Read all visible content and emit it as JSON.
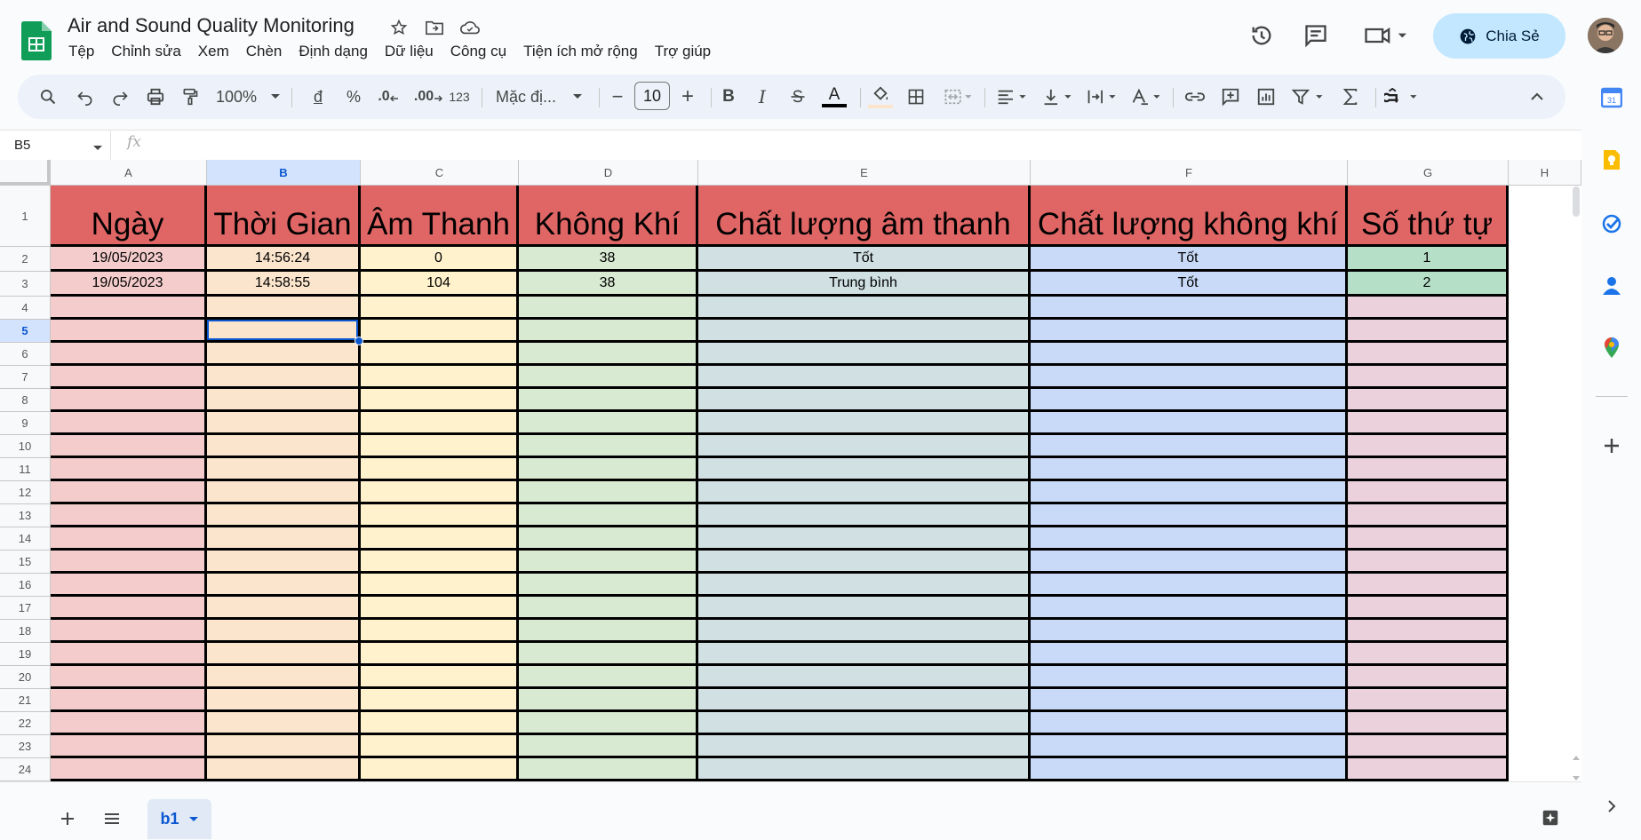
{
  "app": {
    "title": "Air and Sound Quality Monitoring",
    "menus": [
      "Tệp",
      "Chỉnh sửa",
      "Xem",
      "Chèn",
      "Định dạng",
      "Dữ liệu",
      "Công cụ",
      "Tiện ích mở rộng",
      "Trợ giúp"
    ],
    "share_label": "Chia Sẻ"
  },
  "toolbar": {
    "zoom": "100%",
    "currency": "đ",
    "percent": "%",
    "dec_decrease": ".0",
    "dec_increase": ".00",
    "number_format": "123",
    "font": "Mặc đị...",
    "font_size": "10",
    "minus": "−",
    "plus": "+",
    "bold": "B",
    "italic": "I",
    "text_color": "A"
  },
  "formula_bar": {
    "name_box": "B5",
    "fx": "fx",
    "value": ""
  },
  "columns": [
    "A",
    "B",
    "C",
    "D",
    "E",
    "F",
    "G",
    "H"
  ],
  "selected_cell": "B5",
  "rows": [
    {
      "num": "1",
      "cells": [
        "Ngày",
        "Thời Gian",
        "Âm Thanh",
        "Không Khí",
        "Chất lượng âm thanh",
        "Chất lượng không khí",
        "Số thứ tự"
      ]
    },
    {
      "num": "2",
      "cells": [
        "19/05/2023",
        "14:56:24",
        "0",
        "38",
        "Tốt",
        "Tốt",
        "1"
      ]
    },
    {
      "num": "3",
      "cells": [
        "19/05/2023",
        "14:58:55",
        "104",
        "38",
        "Trung bình",
        "Tốt",
        "2"
      ]
    },
    {
      "num": "4",
      "cells": [
        "",
        "",
        "",
        "",
        "",
        "",
        ""
      ]
    },
    {
      "num": "5",
      "cells": [
        "",
        "",
        "",
        "",
        "",
        "",
        ""
      ]
    },
    {
      "num": "6",
      "cells": [
        "",
        "",
        "",
        "",
        "",
        "",
        ""
      ]
    },
    {
      "num": "7",
      "cells": [
        "",
        "",
        "",
        "",
        "",
        "",
        ""
      ]
    },
    {
      "num": "8",
      "cells": [
        "",
        "",
        "",
        "",
        "",
        "",
        ""
      ]
    },
    {
      "num": "9",
      "cells": [
        "",
        "",
        "",
        "",
        "",
        "",
        ""
      ]
    },
    {
      "num": "10",
      "cells": [
        "",
        "",
        "",
        "",
        "",
        "",
        ""
      ]
    },
    {
      "num": "11",
      "cells": [
        "",
        "",
        "",
        "",
        "",
        "",
        ""
      ]
    },
    {
      "num": "12",
      "cells": [
        "",
        "",
        "",
        "",
        "",
        "",
        ""
      ]
    },
    {
      "num": "13",
      "cells": [
        "",
        "",
        "",
        "",
        "",
        "",
        ""
      ]
    },
    {
      "num": "14",
      "cells": [
        "",
        "",
        "",
        "",
        "",
        "",
        ""
      ]
    },
    {
      "num": "15",
      "cells": [
        "",
        "",
        "",
        "",
        "",
        "",
        ""
      ]
    },
    {
      "num": "16",
      "cells": [
        "",
        "",
        "",
        "",
        "",
        "",
        ""
      ]
    },
    {
      "num": "17",
      "cells": [
        "",
        "",
        "",
        "",
        "",
        "",
        ""
      ]
    },
    {
      "num": "18",
      "cells": [
        "",
        "",
        "",
        "",
        "",
        "",
        ""
      ]
    },
    {
      "num": "19",
      "cells": [
        "",
        "",
        "",
        "",
        "",
        "",
        ""
      ]
    },
    {
      "num": "20",
      "cells": [
        "",
        "",
        "",
        "",
        "",
        "",
        ""
      ]
    },
    {
      "num": "21",
      "cells": [
        "",
        "",
        "",
        "",
        "",
        "",
        ""
      ]
    },
    {
      "num": "22",
      "cells": [
        "",
        "",
        "",
        "",
        "",
        "",
        ""
      ]
    },
    {
      "num": "23",
      "cells": [
        "",
        "",
        "",
        "",
        "",
        "",
        ""
      ]
    },
    {
      "num": "24",
      "cells": [
        "",
        "",
        "",
        "",
        "",
        "",
        ""
      ]
    }
  ],
  "colors": {
    "header_row": "#e06666",
    "col_fills": [
      "#f4cccc",
      "#fce5cd",
      "#fff2cc",
      "#d9ead3",
      "#d0e0e3",
      "#c9daf8",
      "#ead1dc"
    ],
    "col_fills_data": [
      "#f4cccc",
      "#fce5cd",
      "#fff2cc",
      "#d9ead3",
      "#d0e0e3",
      "#c9daf8",
      "#b6dfc7"
    ],
    "accent": "#0b57d0"
  },
  "sheets": [
    {
      "name": "b1",
      "active": true
    }
  ]
}
